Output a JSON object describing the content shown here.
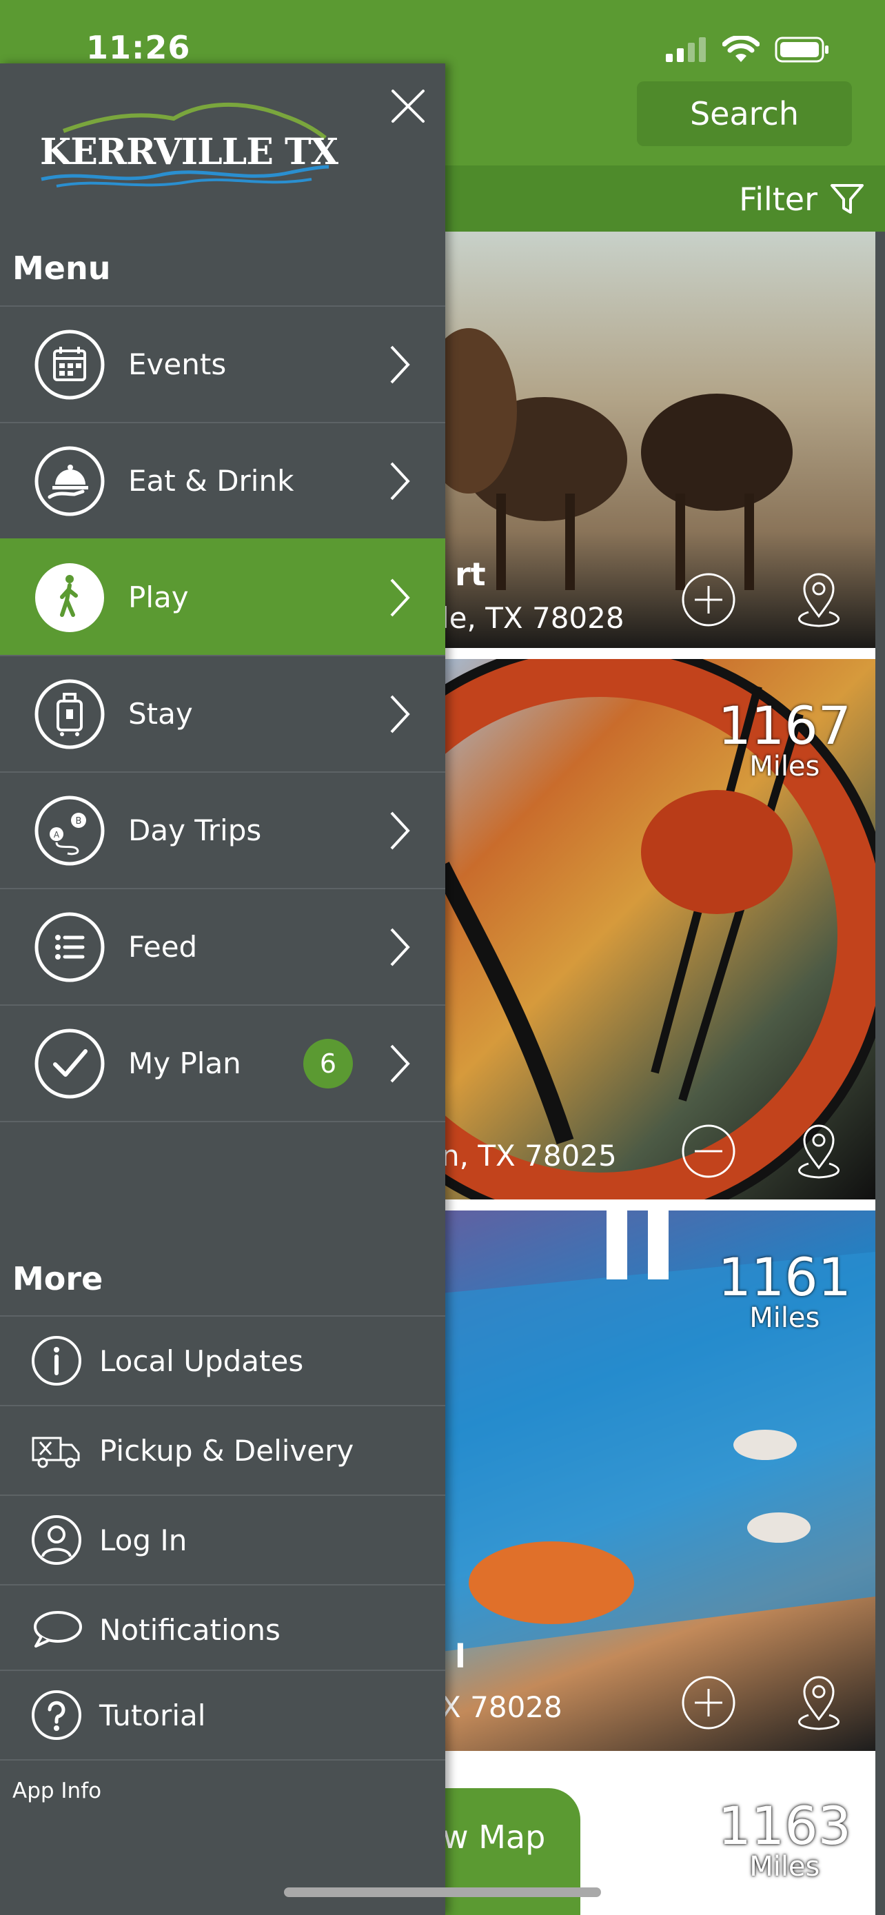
{
  "status_bar": {
    "time": "11:26"
  },
  "header": {
    "search_label": "Search",
    "filter_label": "Filter"
  },
  "cards": [
    {
      "title": "rt",
      "address": "le, TX 78028",
      "action": "add"
    },
    {
      "title": "",
      "address": "n, TX 78025",
      "distance": "1167",
      "unit": "Miles",
      "action": "remove"
    },
    {
      "title": "l",
      "address": "X 78028",
      "distance": "1161",
      "unit": "Miles",
      "action": "add"
    },
    {
      "distance": "1163",
      "unit": "Miles",
      "map_label": "w Map"
    }
  ],
  "drawer": {
    "logo_text": "KERRVILLE TX",
    "menu_title": "Menu",
    "menu_items": [
      {
        "label": "Events",
        "icon": "calendar-icon"
      },
      {
        "label": "Eat & Drink",
        "icon": "food-service-icon"
      },
      {
        "label": "Play",
        "icon": "walking-person-icon",
        "active": true
      },
      {
        "label": "Stay",
        "icon": "luggage-icon"
      },
      {
        "label": "Day Trips",
        "icon": "route-icon"
      },
      {
        "label": "Feed",
        "icon": "list-icon"
      },
      {
        "label": "My Plan",
        "icon": "checkmark-icon",
        "badge": "6"
      }
    ],
    "more_title": "More",
    "more_items": [
      {
        "label": "Local Updates",
        "icon": "info-icon"
      },
      {
        "label": "Pickup & Delivery",
        "icon": "delivery-truck-icon"
      },
      {
        "label": "Log In",
        "icon": "user-icon"
      },
      {
        "label": "Notifications",
        "icon": "chat-bubble-icon"
      },
      {
        "label": "Tutorial",
        "icon": "question-icon"
      }
    ],
    "app_info": "App Info"
  },
  "colors": {
    "brand_green": "#5b9a32",
    "drawer_bg": "#4a5052"
  }
}
